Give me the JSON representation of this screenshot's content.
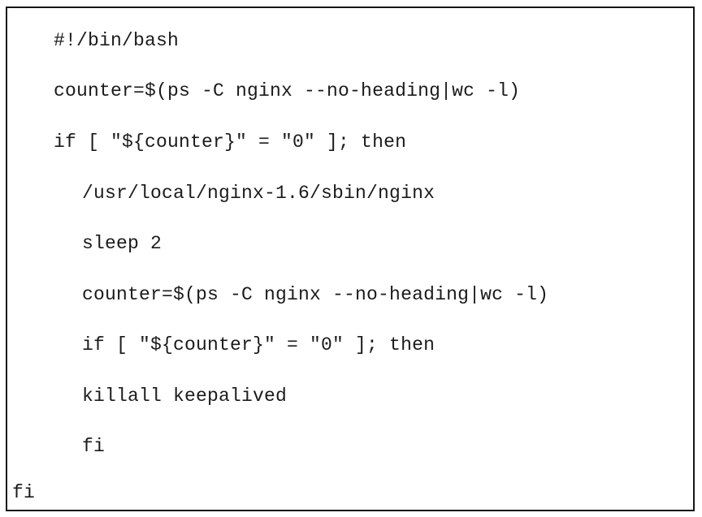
{
  "figure": {
    "kind": "code-listing",
    "language": "bash",
    "background_color": "#ffffff",
    "border_color": "#161616",
    "text_color": "#1b1b1b"
  },
  "code": {
    "lines": [
      {
        "text": "#!/bin/bash",
        "indent": "ind-0"
      },
      {
        "text": "counter=$(ps -C nginx --no-heading|wc -l)",
        "indent": "ind-0"
      },
      {
        "text": "if [ ″${counter}″ = ″0″ ]; then",
        "indent": "ind-0"
      },
      {
        "text": "/usr/local/nginx-1.6/sbin/nginx",
        "indent": "ind-1"
      },
      {
        "text": "sleep 2",
        "indent": "ind-1"
      },
      {
        "text": "counter=$(ps -C nginx --no-heading|wc -l)",
        "indent": "ind-1"
      },
      {
        "text": "if [ ″${counter}″ = ″0″ ]; then",
        "indent": "ind-1"
      },
      {
        "text": "killall keepalived",
        "indent": "ind-1"
      },
      {
        "text": "fi",
        "indent": "ind-1"
      },
      {
        "text": "fi",
        "indent": "ind-out"
      }
    ]
  }
}
